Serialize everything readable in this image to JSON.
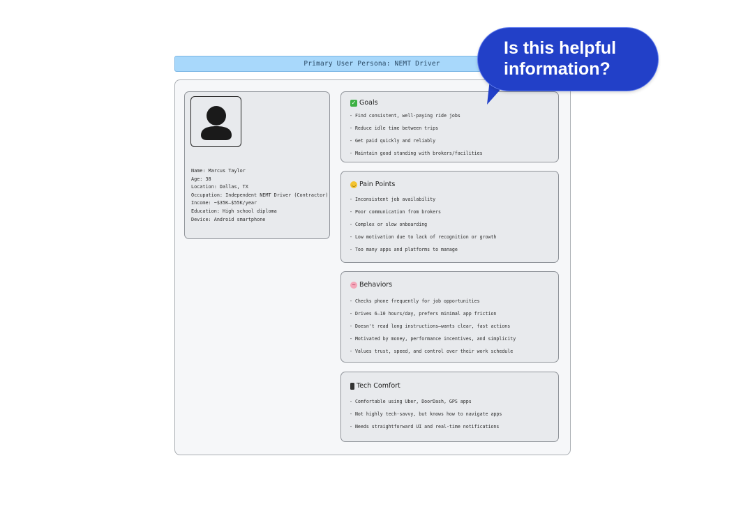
{
  "header": {
    "title": "Primary User Persona: NEMT Driver"
  },
  "profile": {
    "avatar_icon": "user-silhouette-icon",
    "fields": [
      "Name: Marcus Taylor",
      "Age: 38",
      "Location: Dallas, TX",
      "Occupation: Independent NEMT Driver (Contractor)",
      "Income: ~$35K–$55K/year",
      "Education: High school diploma",
      "Device: Android smartphone"
    ]
  },
  "sections": [
    {
      "icon": "check-mark-icon",
      "title": "Goals",
      "items": [
        "- Find consistent, well-paying ride jobs",
        "- Reduce idle time between trips",
        "- Get paid quickly and reliably",
        "- Maintain good standing with brokers/facilities"
      ]
    },
    {
      "icon": "weary-face-icon",
      "title": "Pain Points",
      "items": [
        "- Inconsistent job availability",
        "- Poor communication from brokers",
        "- Complex or slow onboarding",
        "- Low motivation due to lack of recognition or growth",
        "- Too many apps and platforms to manage"
      ]
    },
    {
      "icon": "brain-icon",
      "title": "Behaviors",
      "items": [
        "- Checks phone frequently for job opportunities",
        "- Drives 6–10 hours/day, prefers minimal app friction",
        "- Doesn't read long instructions—wants clear, fast actions",
        "- Motivated by money, performance incentives, and simplicity",
        "- Values trust, speed, and control over their work schedule"
      ]
    },
    {
      "icon": "mobile-phone-icon",
      "title": "Tech Comfort",
      "items": [
        "- Comfortable using Uber, DoorDash, GPS apps",
        "- Not highly tech-savvy, but knows how to navigate apps",
        "- Needs straightforward UI and real-time notifications"
      ]
    }
  ],
  "feedback_bubble": {
    "text": "Is this helpful information?",
    "color": "#2240c8"
  }
}
